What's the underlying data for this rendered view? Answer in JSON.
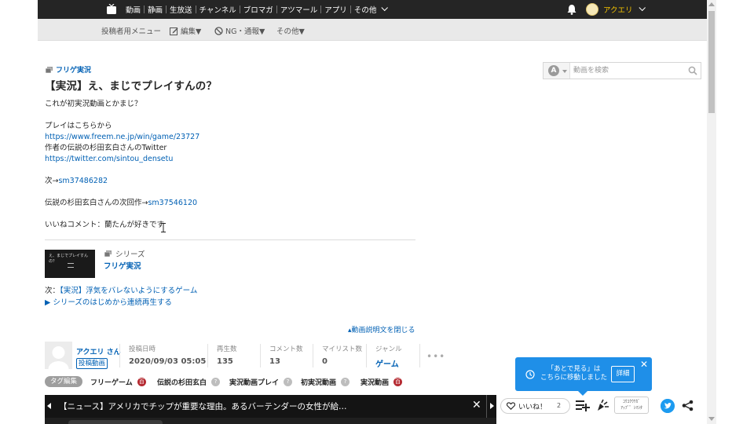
{
  "top_nav": {
    "items": [
      "動画",
      "静画",
      "生放送",
      "チャンネル",
      "ブロマガ",
      "アツマール",
      "アプリ",
      "その他"
    ],
    "user_name": "アクエリ"
  },
  "sub_menu": {
    "title": "投稿者用メニュー",
    "items": [
      "編集▼",
      "NG・通報▼",
      "その他▼"
    ]
  },
  "search": {
    "placeholder": "動画を検索",
    "selector_letter": "A"
  },
  "video": {
    "series_link": "フリゲ実況",
    "title": "【実況】え、まじでプレイすんの？",
    "description_lines": [
      {
        "text": "これが初実況動画とかまじ？"
      },
      {
        "text": ""
      },
      {
        "text": "プレイはこちらから"
      },
      {
        "text": "https://www.freem.ne.jp/win/game/23727",
        "link": true
      },
      {
        "text": "作者の伝説の杉田玄白さんのTwitter"
      },
      {
        "text": "https://twitter.com/sintou_densetu",
        "link": true
      },
      {
        "text": ""
      },
      {
        "prefix": "次→",
        "text": "sm37486282",
        "link": true
      },
      {
        "text": ""
      },
      {
        "prefix": "伝説の杉田玄白さんの次回作→",
        "text": "sm37546120",
        "link": true
      },
      {
        "text": ""
      },
      {
        "text": "いいねコメント：蘭たんが好きです"
      }
    ]
  },
  "series": {
    "label": "シリーズ",
    "name": "フリゲ実況",
    "thumb_text": "え、まじでプレイすんの？",
    "next_prefix": "次：",
    "next_title": "【実況】浮気をバレないようにするゲーム",
    "play_all": "▶ シリーズのはじめから連続再生する"
  },
  "close_description": "▴動画説明文を閉じる",
  "uploader": {
    "name": "アクエリ さん",
    "badge": "投稿動画"
  },
  "stats": [
    {
      "label": "投稿日時",
      "value": "2020/09/03 05:05"
    },
    {
      "label": "再生数",
      "value": "135"
    },
    {
      "label": "コメント数",
      "value": "13"
    },
    {
      "label": "マイリスト数",
      "value": "0"
    },
    {
      "label": "ジャンル",
      "value": "ゲーム"
    }
  ],
  "tags": {
    "edit_label": "タグ編集",
    "items": [
      {
        "text": "フリーゲーム",
        "badge": "百",
        "badge_color": "#b52b32"
      },
      {
        "text": "伝説の杉田玄白",
        "badge": "?",
        "badge_color": "#bdbdbd"
      },
      {
        "text": "実況動画プレイ",
        "badge": "?",
        "badge_color": "#bdbdbd"
      },
      {
        "text": "初実況動画",
        "badge": "?",
        "badge_color": "#bdbdbd"
      },
      {
        "text": "実況動画",
        "badge": "百",
        "badge_color": "#b52b32"
      }
    ]
  },
  "news": {
    "text": "【ニュース】アメリカでチップが重要な理由。あるバーテンダーの女性が給…",
    "close": "✕"
  },
  "toast": {
    "message_line1": "「あとで見る」は",
    "message_line2": "こちらに移動しました",
    "detail": "詳細",
    "close": "✕"
  },
  "actions": {
    "like_label": "いいね！",
    "like_count": "2",
    "uad_label_1": "ｺｳｺｸｳｹｶﾞ",
    "uad_label_2": "ｱｯﾌﾟ゜ｼﾏｼﾀ"
  },
  "colors": {
    "link": "#0060b4",
    "topbar": "#252525",
    "toast": "#1f8fe8",
    "user_name": "#f3c200"
  }
}
